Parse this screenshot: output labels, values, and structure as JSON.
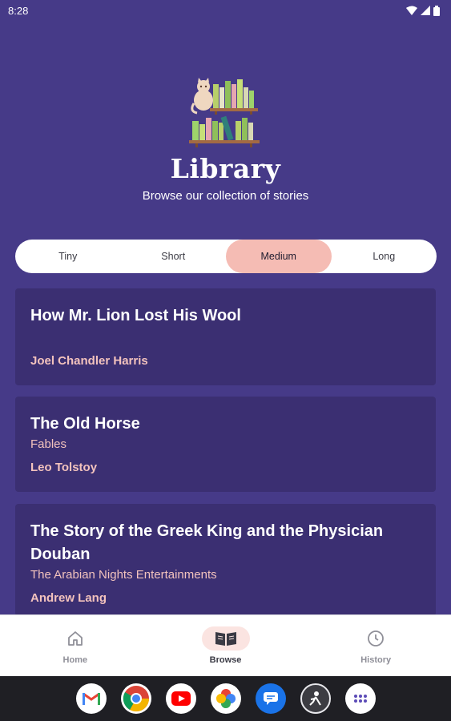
{
  "status": {
    "time": "8:28"
  },
  "header": {
    "title": "Library",
    "subtitle": "Browse our collection of stories"
  },
  "length_filter": {
    "options": [
      "Tiny",
      "Short",
      "Medium",
      "Long"
    ],
    "selected": "Medium"
  },
  "stories": [
    {
      "title": "How Mr. Lion Lost His Wool",
      "collection": "",
      "author": "Joel Chandler Harris"
    },
    {
      "title": "The Old Horse",
      "collection": "Fables",
      "author": "Leo Tolstoy"
    },
    {
      "title": "The Story of the Greek King and the Physician Douban",
      "collection": "The Arabian Nights Entertainments",
      "author": "Andrew Lang"
    }
  ],
  "bottom_nav": {
    "items": [
      {
        "label": "Home",
        "icon": "home-icon"
      },
      {
        "label": "Browse",
        "icon": "book-icon"
      },
      {
        "label": "History",
        "icon": "clock-icon"
      }
    ],
    "selected": "Browse"
  },
  "dock": {
    "apps": [
      "gmail-icon",
      "chrome-icon",
      "youtube-icon",
      "photos-icon",
      "messages-icon",
      "app-icon",
      "app-drawer-icon"
    ]
  },
  "colors": {
    "background": "#463a88",
    "card": "#3b2f72",
    "accent": "#f5bcb4",
    "author_text": "#f3c3bd"
  }
}
